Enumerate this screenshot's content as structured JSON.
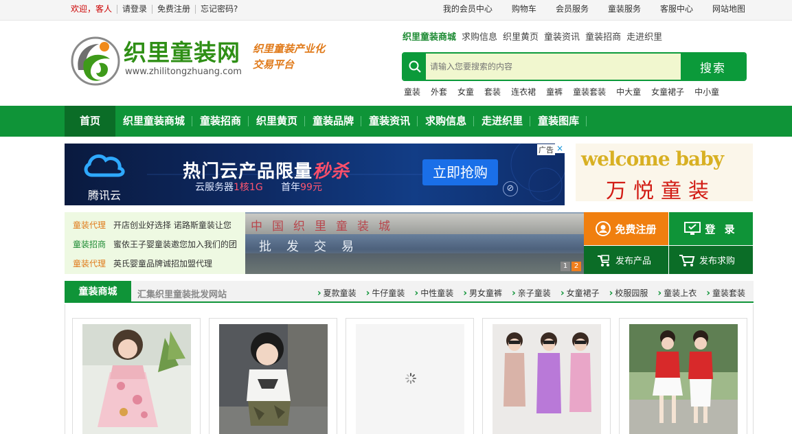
{
  "topbar": {
    "welcome": "欢迎，客人",
    "login": "请登录",
    "register": "免费注册",
    "forgot": "忘记密码?",
    "right_links": [
      "我的会员中心",
      "购物车",
      "会员服务",
      "童装服务",
      "客服中心",
      "网站地图"
    ]
  },
  "logo": {
    "title": "织里童装网",
    "url": "www.zhilitongzhuang.com",
    "slogan_line1": "织里童装产业化",
    "slogan_line2": "交易平台"
  },
  "quicklinks": [
    "织里童装商城",
    "求购信息",
    "织里黄页",
    "童装资讯",
    "童装招商",
    "走进织里"
  ],
  "search": {
    "placeholder": "请输入您要搜索的内容",
    "button": "搜索"
  },
  "hotwords": [
    "童装",
    "外套",
    "女童",
    "套装",
    "连衣裙",
    "童裤",
    "童装套装",
    "中大童",
    "女童裙子",
    "中小童"
  ],
  "nav": [
    "首页",
    "织里童装商城",
    "童装招商",
    "织里黄页",
    "童装品牌",
    "童装资讯",
    "求购信息",
    "走进织里",
    "童装图库"
  ],
  "ad": {
    "label": "广告",
    "close": "×",
    "brand": "腾讯云",
    "main_a": "热门云产品限量",
    "main_b": "秒杀",
    "sub_a": "云服务器",
    "sub_b": "1核1G",
    "sub_c": "首年",
    "sub_d": "99元",
    "cta": "立即抢购"
  },
  "side_ad": {
    "welcome": "welcome baby",
    "brand": "万悦童装"
  },
  "news": [
    {
      "tag": "童装代理",
      "text": "开店创业好选择 诺路斯童装让您"
    },
    {
      "tag": "童装招商",
      "text": "蜜依王子婴童装邀您加入我们的团"
    },
    {
      "tag": "童装代理",
      "text": "英氏婴童品牌诚招加盟代理"
    }
  ],
  "photo": {
    "sign": "中国织里童装城",
    "store": "批发交易",
    "pages": [
      "1",
      "2"
    ]
  },
  "actions": {
    "register": "免费注册",
    "login": "登 录",
    "publish": "发布产品",
    "buy": "发布求购"
  },
  "section": {
    "title": "童装商城",
    "subtitle": "汇集织里童装批发网站",
    "links": [
      "夏款童装",
      "牛仔童装",
      "中性童装",
      "男女童裤",
      "亲子童装",
      "女童裙子",
      "校服园服",
      "童装上衣",
      "童装套装"
    ]
  },
  "colors": {
    "brand_green": "#0f9438",
    "dark_green": "#0b6d27",
    "orange": "#f07f0f"
  }
}
